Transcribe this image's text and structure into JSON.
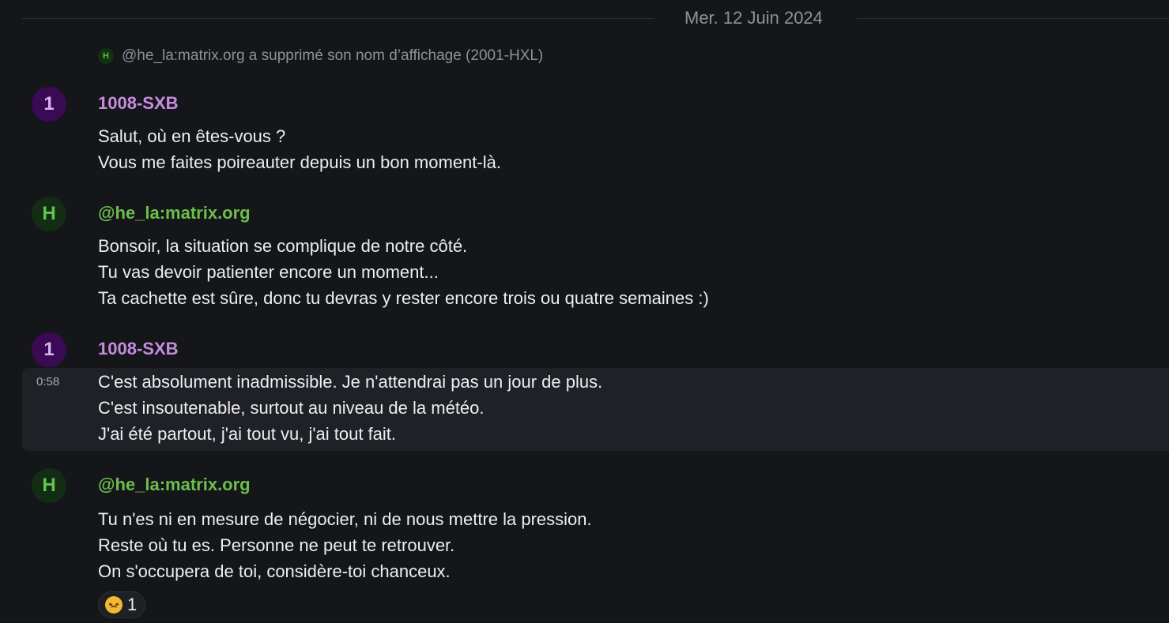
{
  "date_separator": "Mer. 12 Juin 2024",
  "state_event": {
    "avatar_initial": "H",
    "text": "@he_la:matrix.org a supprimé son nom d’affichage (2001-HXL)"
  },
  "messages": [
    {
      "avatar_initial": "1",
      "sender": "1008-SXB",
      "lines": [
        "Salut, où en êtes-vous ?",
        "Vous me faites poireauter depuis un bon moment-là."
      ]
    },
    {
      "avatar_initial": "H",
      "sender": "@he_la:matrix.org",
      "lines": [
        "Bonsoir, la situation se complique de notre côté.",
        "Tu vas devoir patienter encore un moment...",
        "Ta cachette est sûre, donc tu devras y rester encore trois ou quatre semaines :)"
      ]
    },
    {
      "avatar_initial": "1",
      "sender": "1008-SXB",
      "timestamp": "0:58",
      "lines": [
        "C'est absolument inadmissible. Je n'attendrai pas un jour de plus.",
        "C'est insoutenable, surtout au niveau de la météo.",
        "J'ai été partout, j'ai tout vu, j'ai tout fait."
      ]
    },
    {
      "avatar_initial": "H",
      "sender": "@he_la:matrix.org",
      "lines": [
        "Tu n'es ni en mesure de négocier, ni de nous mettre la pression.",
        "Reste où tu es. Personne ne peut te retrouver.",
        "On s'occupera de toi, considère-toi chanceux."
      ],
      "reaction": {
        "emoji": "angry-face-icon",
        "count": "1"
      }
    }
  ],
  "colors": {
    "background": "#15161a",
    "sender_1008": "#c68cdd",
    "sender_he_la": "#6bbf4a",
    "hover_row": "#202126"
  }
}
